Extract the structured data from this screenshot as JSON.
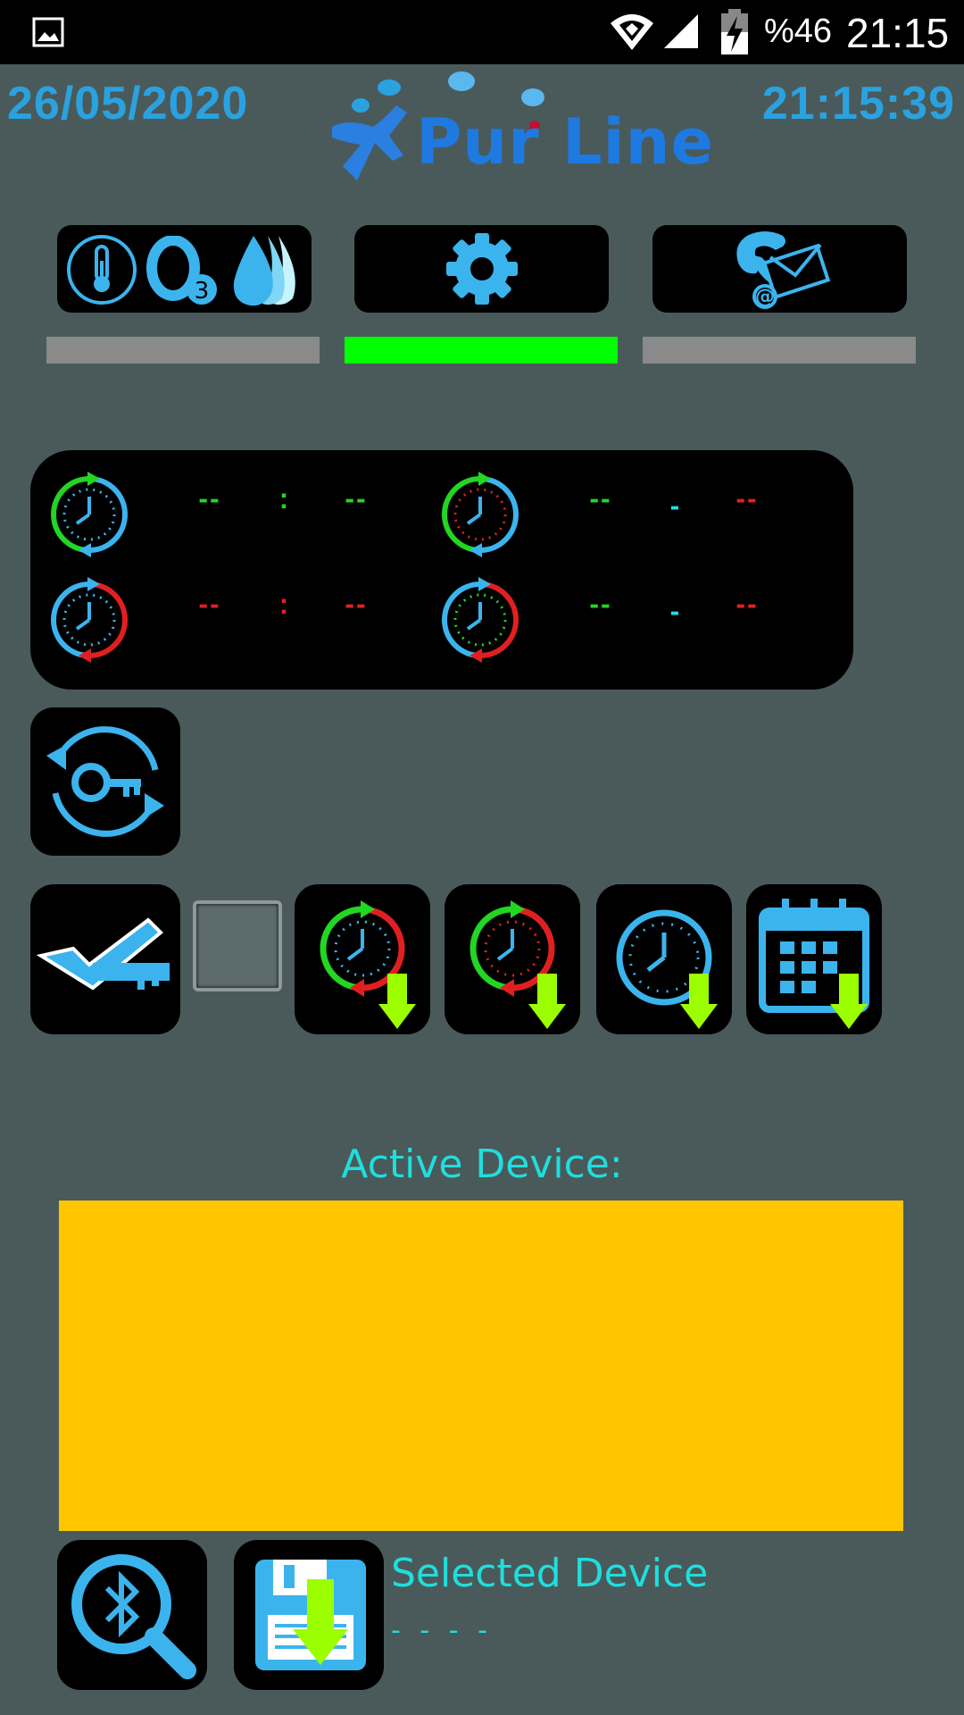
{
  "status_bar": {
    "battery_text": "%46",
    "clock": "21:15",
    "icons": [
      "image-icon",
      "wifi-icon",
      "cell-signal-icon",
      "battery-charging-icon"
    ]
  },
  "header": {
    "date": "26/05/2020",
    "time": "21:15:39",
    "logo_text": "Pur Line"
  },
  "top_buttons": [
    {
      "name": "sensors-button",
      "icons": [
        "thermometer-icon",
        "ozone-icon",
        "water-drops-icon"
      ]
    },
    {
      "name": "settings-button",
      "icons": [
        "gear-icon"
      ]
    },
    {
      "name": "contact-button",
      "icons": [
        "phone-mail-icon"
      ]
    }
  ],
  "status_bars": [
    {
      "color": "#8a8a8a",
      "state": "inactive"
    },
    {
      "color": "#00ff00",
      "state": "active"
    },
    {
      "color": "#8a8a8a",
      "state": "inactive"
    }
  ],
  "timers": {
    "row1": {
      "left": {
        "a": "--",
        "sep": ":",
        "b": "--"
      },
      "right": {
        "a": "--",
        "sep": "-",
        "b": "--"
      }
    },
    "row2": {
      "left": {
        "a": "--",
        "sep": ":",
        "b": "--"
      },
      "right": {
        "a": "--",
        "sep": "-",
        "b": "--"
      }
    }
  },
  "colors": {
    "background": "#4a5a5a",
    "accent_blue": "#2aa2e0",
    "icon_blue": "#3bb4ee",
    "green": "#22d622",
    "red": "#e02020",
    "cyan_text": "#20dede",
    "active_box": "#ffc600",
    "arrow_green": "#9cff00"
  },
  "buttons": {
    "key_rotate": "key-rotate-icon",
    "key_check": "key-check-icon",
    "checkbox_checked": false,
    "download_buttons": [
      "timer-on-off-download",
      "timer-random-download",
      "clock-download",
      "calendar-download"
    ],
    "bluetooth_search": "bluetooth-search-icon",
    "save": "floppy-save-icon"
  },
  "active_device": {
    "label": "Active Device:",
    "content": ""
  },
  "selected_device": {
    "label": "Selected Device",
    "value": "- - - -"
  }
}
